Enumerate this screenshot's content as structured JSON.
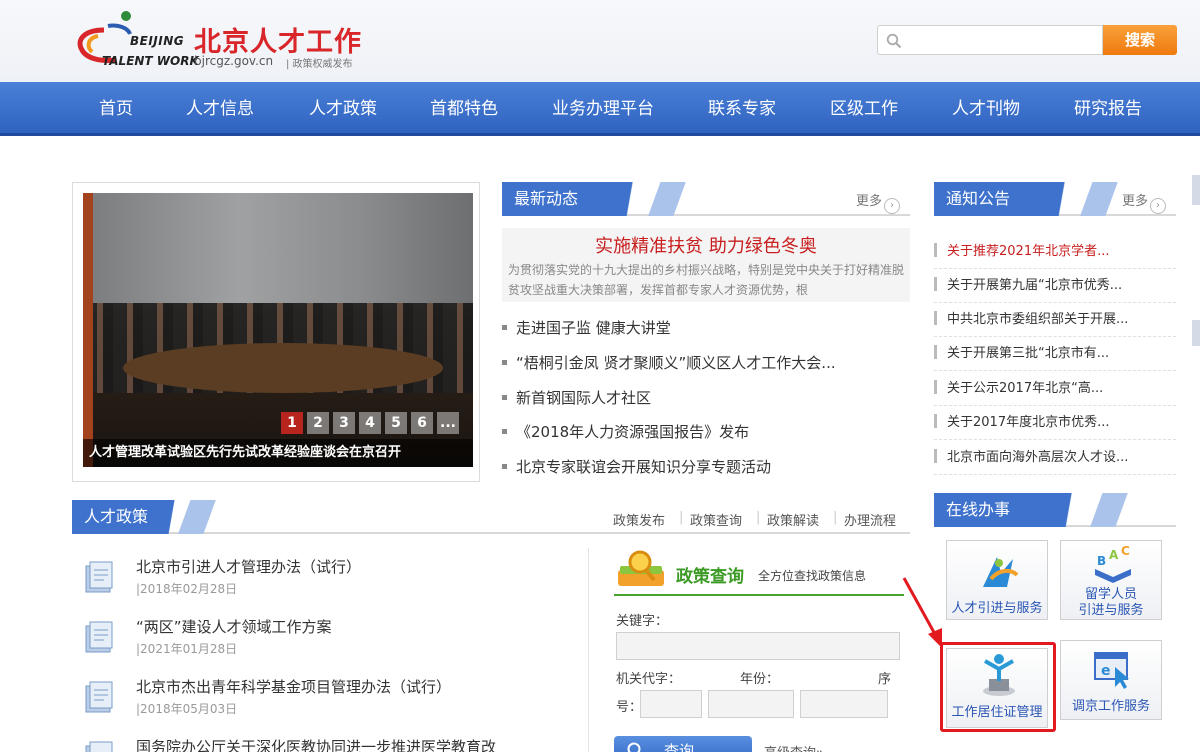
{
  "header": {
    "logo_en_line1": "BEIJING",
    "logo_en_line2": "TALENT WORK",
    "logo_cn": "北京人才工作",
    "domain": "bjrcgz.gov.cn",
    "slogan": "| 政策权威发布",
    "search_placeholder": "",
    "search_button": "搜索"
  },
  "nav": [
    "首页",
    "人才信息",
    "人才政策",
    "首都特色",
    "业务办理平台",
    "联系专家",
    "区级工作",
    "人才刊物",
    "研究报告"
  ],
  "carousel": {
    "caption": "人才管理改革试验区先行先试改革经验座谈会在京召开",
    "pages": [
      "1",
      "2",
      "3",
      "4",
      "5",
      "6",
      "..."
    ],
    "active_page": 1
  },
  "news": {
    "title": "最新动态",
    "more": "更多",
    "headline_title": "实施精准扶贫 助力绿色冬奥",
    "headline_desc": "为贯彻落实党的十九大提出的乡村振兴战略，特别是党中央关于打好精准脱贫攻坚战重大决策部署，发挥首都专家人才资源优势，根",
    "items": [
      "走进国子监  健康大讲堂",
      "“梧桐引金凤 贤才聚顺义”顺义区人才工作大会...",
      "新首钢国际人才社区",
      "《2018年人力资源强国报告》发布",
      "北京专家联谊会开展知识分享专题活动"
    ]
  },
  "notice": {
    "title": "通知公告",
    "more": "更多",
    "items": [
      "关于推荐2021年北京学者...",
      "关于开展第九届“北京市优秀...",
      "中共北京市委组织部关于开展...",
      "关于开展第三批“北京市有...",
      "关于公示2017年北京“高...",
      "关于2017年度北京市优秀...",
      "北京市面向海外高层次人才设..."
    ]
  },
  "policy": {
    "title": "人才政策",
    "links": [
      "政策发布",
      "政策查询",
      "政策解读",
      "办理流程"
    ],
    "items": [
      {
        "title": "北京市引进人才管理办法（试行）",
        "date": "|2018年02月28日"
      },
      {
        "title": "“两区”建设人才领域工作方案",
        "date": "|2021年01月28日"
      },
      {
        "title": "北京市杰出青年科学基金项目管理办法（试行）",
        "date": "|2018年05月03日"
      },
      {
        "title": "国务院办公厅关于深化医教协同进一步推进医学教育改",
        "date": ""
      }
    ]
  },
  "query": {
    "title": "政策查询",
    "subtitle": "全方位查找政策信息",
    "keyword_label": "关键字：",
    "org_label": "机关代字：",
    "year_label": "年份：",
    "seq_label_1": "序",
    "seq_label_2": "号：",
    "button": "查询",
    "advanced": "高级查询»"
  },
  "online": {
    "title": "在线办事",
    "services": [
      {
        "line1": "人才引进与服务",
        "line2": ""
      },
      {
        "line1": "留学人员",
        "line2": "引进与服务"
      },
      {
        "line1": "工作居住证管理",
        "line2": ""
      },
      {
        "line1": "调京工作服务",
        "line2": ""
      }
    ]
  },
  "colors": {
    "nav_blue": "#3a6fcc",
    "accent_orange": "#f2861f",
    "headline_red": "#c81e1e",
    "highlight_red": "#e2191e",
    "query_green": "#3a9a24"
  }
}
